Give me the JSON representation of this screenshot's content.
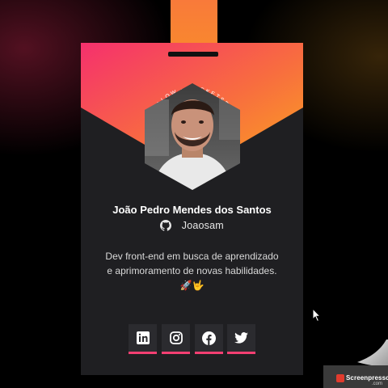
{
  "profile": {
    "name": "João Pedro Mendes dos Santos",
    "github_handle": "Joaosam",
    "bio": "Dev front-end em busca de aprendizado e aprimoramento de novas habilidades. 🚀🤟"
  },
  "badge_ring_text": "ME FOLLOW • ROCKETSEAT • DEV FRONT",
  "social_links": [
    {
      "name": "linkedin",
      "icon": "linkedin-icon"
    },
    {
      "name": "instagram",
      "icon": "instagram-icon"
    },
    {
      "name": "facebook",
      "icon": "facebook-icon"
    },
    {
      "name": "twitter",
      "icon": "twitter-icon"
    }
  ],
  "colors": {
    "gradient_start": "#f5306d",
    "gradient_end": "#fba51e",
    "card_bg": "#1f1f22",
    "accent_underline": "#f43f72",
    "icon_bg": "#2b2b2f"
  },
  "watermark": {
    "text": "Screenpresso",
    "domain": ".com"
  }
}
